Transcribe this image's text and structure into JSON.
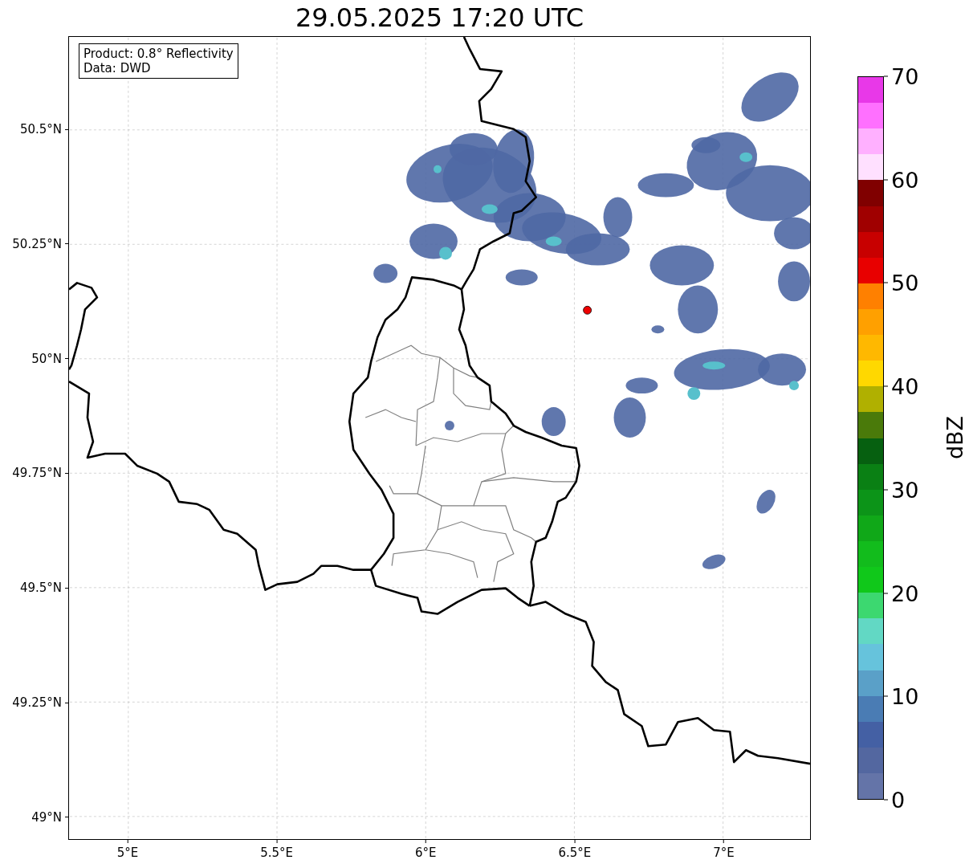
{
  "title": "29.05.2025 17:20 UTC",
  "map": {
    "info_box": [
      "Product: 0.8° Reflectivity",
      "Data: DWD"
    ],
    "yticks": [
      "50.5°N",
      "50.25°N",
      "50°N",
      "49.75°N",
      "49.5°N",
      "49.25°N",
      "49°N"
    ],
    "xticks": [
      "5°E",
      "5.5°E",
      "6°E",
      "6.5°E",
      "7°E"
    ]
  },
  "colorbar": {
    "label": "dBZ",
    "ticks": [
      "70",
      "60",
      "50",
      "40",
      "30",
      "20",
      "10",
      "0"
    ],
    "segments": [
      {
        "color": "#e838e8"
      },
      {
        "color": "#ff70ff"
      },
      {
        "color": "#ffb0ff"
      },
      {
        "color": "#ffe0ff"
      },
      {
        "color": "#800000"
      },
      {
        "color": "#a00000"
      },
      {
        "color": "#c80000"
      },
      {
        "color": "#e80000"
      },
      {
        "color": "#ff8000"
      },
      {
        "color": "#ffa000"
      },
      {
        "color": "#ffb800"
      },
      {
        "color": "#ffd800"
      },
      {
        "color": "#b0b000"
      },
      {
        "color": "#4a7a0a"
      },
      {
        "color": "#066010"
      },
      {
        "color": "#0a8014"
      },
      {
        "color": "#0c9418"
      },
      {
        "color": "#10a818"
      },
      {
        "color": "#12bc1c"
      },
      {
        "color": "#10c81a"
      },
      {
        "color": "#3cd870"
      },
      {
        "color": "#62d8c4"
      },
      {
        "color": "#66c3dc"
      },
      {
        "color": "#5aa0c8"
      },
      {
        "color": "#4a7cb4"
      },
      {
        "color": "#4460a4"
      },
      {
        "color": "#5367a0"
      },
      {
        "color": "#6474a8"
      }
    ]
  }
}
